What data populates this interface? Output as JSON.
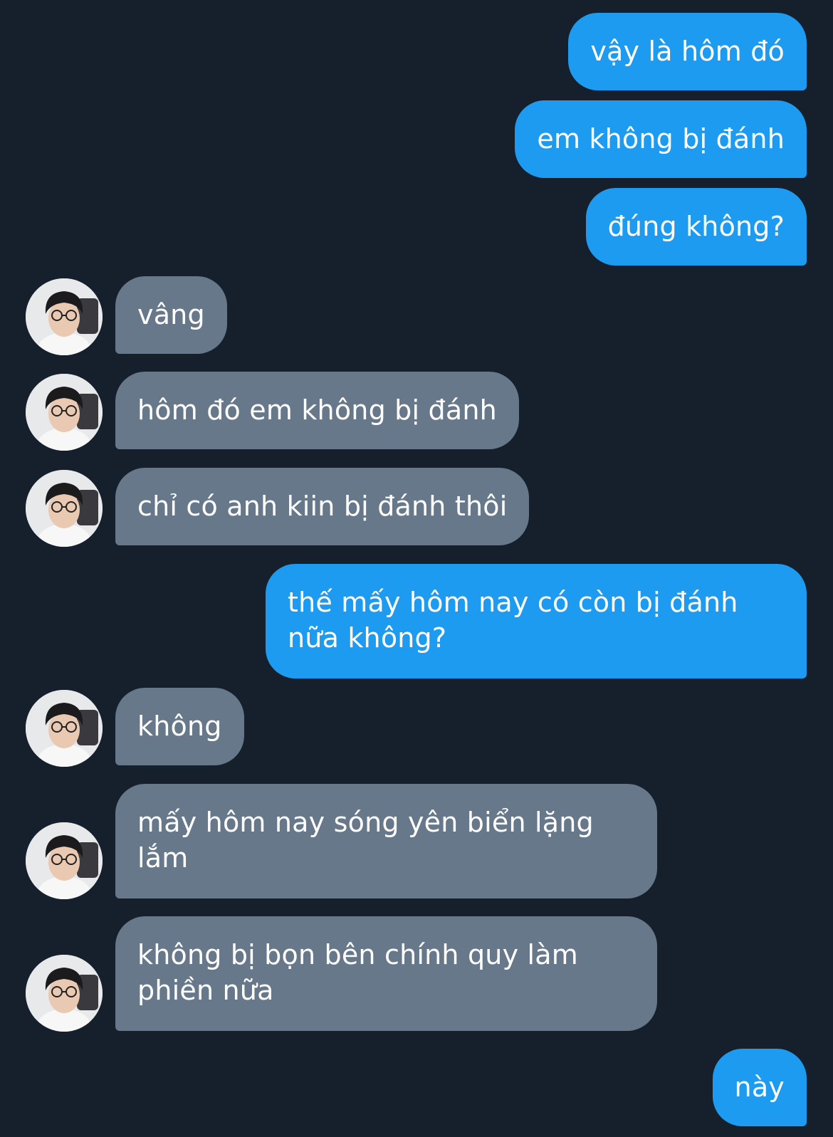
{
  "messages": [
    {
      "dir": "sent",
      "text": "vậy là hôm đó"
    },
    {
      "dir": "sent",
      "text": "em không bị đánh"
    },
    {
      "dir": "sent",
      "text": "đúng không?"
    },
    {
      "dir": "recv",
      "text": "vâng"
    },
    {
      "dir": "recv",
      "text": "hôm đó em không bị đánh"
    },
    {
      "dir": "recv",
      "text": "chỉ có anh kiin bị đánh thôi"
    },
    {
      "dir": "sent",
      "text": "thế mấy hôm nay có còn bị đánh nữa không?"
    },
    {
      "dir": "recv",
      "text": "không"
    },
    {
      "dir": "recv",
      "text": "mấy hôm nay sóng yên biển lặng lắm"
    },
    {
      "dir": "recv",
      "text": "không bị bọn bên chính quy làm phiền nữa"
    },
    {
      "dir": "sent",
      "text": "này"
    }
  ],
  "colors": {
    "background": "#16202c",
    "sent_bubble": "#1d9bf0",
    "received_bubble": "#66788a",
    "text": "#ffffff"
  },
  "icons": {
    "avatar": "user-avatar-photo"
  }
}
